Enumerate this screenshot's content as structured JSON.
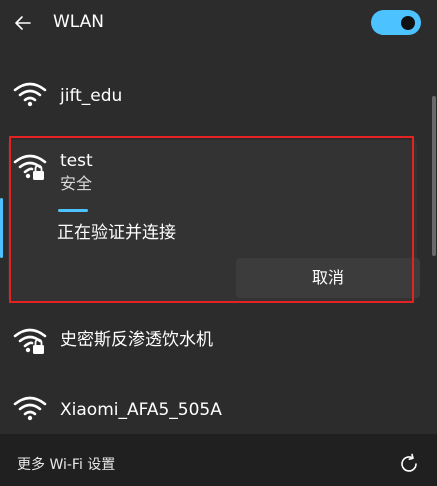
{
  "header": {
    "title": "WLAN",
    "back_icon": "arrow-left-icon",
    "toggle_state": "on",
    "accent_color": "#4cc2ff"
  },
  "networks": [
    {
      "name": "jift_edu",
      "secured": false,
      "icon": "wifi-icon"
    },
    {
      "name": "test",
      "status": "安全",
      "secured": true,
      "icon": "wifi-secured-icon"
    },
    {
      "name": "史密斯反渗透饮水机",
      "secured": true,
      "icon": "wifi-secured-icon"
    },
    {
      "name": "Xiaomi_AFA5_505A",
      "secured": false,
      "icon": "wifi-icon"
    }
  ],
  "connecting": {
    "message": "正在验证并连接",
    "cancel_label": "取消"
  },
  "footer": {
    "more_settings_label": "更多 Wi-Fi 设置",
    "refresh_icon": "refresh-icon"
  },
  "highlight_color": "#e52222"
}
